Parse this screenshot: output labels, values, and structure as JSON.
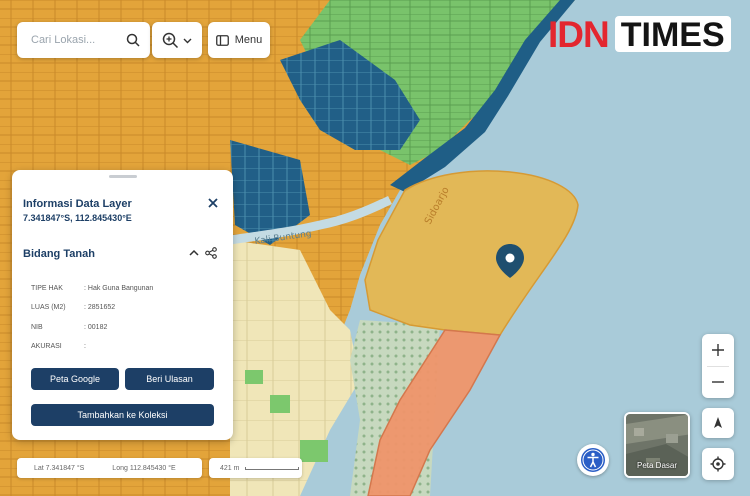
{
  "search": {
    "placeholder": "Cari Lokasi..."
  },
  "toolbar": {
    "menu_label": "Menu"
  },
  "brand": {
    "part1": "IDN",
    "part2": "TIMES"
  },
  "info_panel": {
    "title": "Informasi Data Layer",
    "coordinates": "7.341847°S, 112.845430°E",
    "section_title": "Bidang Tanah",
    "attributes": [
      {
        "label": "TIPE HAK",
        "value": ": Hak Guna Bangunan"
      },
      {
        "label": "LUAS (M2)",
        "value": ": 2851652"
      },
      {
        "label": "NIB",
        "value": ": 00182"
      },
      {
        "label": "AKURASI",
        "value": ":"
      }
    ],
    "buttons": {
      "google": "Peta Google",
      "review": "Beri Ulasan",
      "collection": "Tambahkan ke Koleksi"
    }
  },
  "map_labels": {
    "river": "Kali Buntung",
    "sea_area": "Sidoarjo"
  },
  "basemap": {
    "label": "Peta Dasar"
  },
  "status": {
    "lat": "Lat 7.341847 °S",
    "long": "Long 112.845430 °E",
    "scale": "421 m"
  },
  "colors": {
    "sea": "#a9cbd9",
    "parcel_orange": "#e8a93a",
    "parcel_green": "#6dbb5f",
    "parcel_blue": "#1f5e86",
    "highlight_yellow": "#e7b64c",
    "highlight_salmon": "#ef956a",
    "panel_dark": "#1d3f66",
    "brand_red": "#e3262f"
  },
  "icons": [
    "search-icon",
    "zoom-in-icon",
    "chevron-down-icon",
    "sidebar-icon",
    "close-icon",
    "chevron-up-icon",
    "share-icon",
    "map-pin-icon",
    "plus-icon",
    "minus-icon",
    "compass-icon",
    "locate-icon",
    "accessibility-icon"
  ]
}
